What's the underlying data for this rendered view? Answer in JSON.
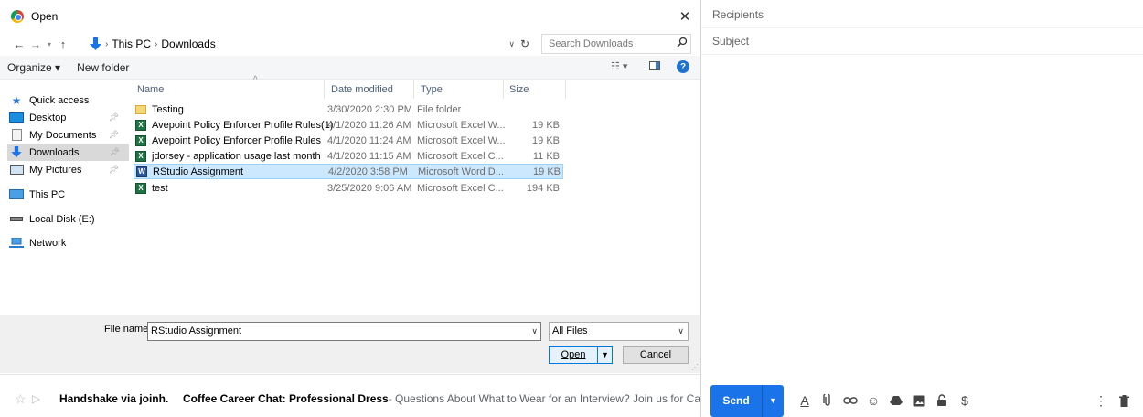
{
  "dialog": {
    "title": "Open",
    "address": {
      "crumbs": [
        "This PC",
        "Downloads"
      ]
    },
    "search_placeholder": "Search Downloads",
    "toolbar": {
      "organize": "Organize ▾",
      "new_folder": "New folder"
    },
    "sidebar": [
      {
        "label": "Quick access",
        "icon": "star-icon"
      },
      {
        "label": "Desktop",
        "icon": "desktop-icon",
        "pinned": true
      },
      {
        "label": "My Documents",
        "icon": "document-icon",
        "pinned": true
      },
      {
        "label": "Downloads",
        "icon": "download-arrow-icon",
        "pinned": true,
        "selected": true
      },
      {
        "label": "My Pictures",
        "icon": "pictures-icon",
        "pinned": true
      },
      {
        "label": "This PC",
        "icon": "computer-icon"
      },
      {
        "label": "Local Disk (E:)",
        "icon": "disk-icon"
      },
      {
        "label": "Network",
        "icon": "network-icon"
      }
    ],
    "columns": {
      "name": "Name",
      "date": "Date modified",
      "type": "Type",
      "size": "Size"
    },
    "files": [
      {
        "name": "Testing",
        "date": "3/30/2020 2:30 PM",
        "type": "File folder",
        "size": "",
        "icon": "folder-icon"
      },
      {
        "name": "Avepoint Policy Enforcer Profile Rules(1)",
        "date": "4/1/2020 11:26 AM",
        "type": "Microsoft Excel W...",
        "size": "19 KB",
        "icon": "excel-file-icon"
      },
      {
        "name": "Avepoint Policy Enforcer Profile Rules",
        "date": "4/1/2020 11:24 AM",
        "type": "Microsoft Excel W...",
        "size": "19 KB",
        "icon": "excel-file-icon"
      },
      {
        "name": "jdorsey - application usage last month",
        "date": "4/1/2020 11:15 AM",
        "type": "Microsoft Excel C...",
        "size": "11 KB",
        "icon": "excel-file-icon"
      },
      {
        "name": "RStudio Assignment",
        "date": "4/2/2020 3:58 PM",
        "type": "Microsoft Word D...",
        "size": "19 KB",
        "icon": "word-file-icon",
        "selected": true
      },
      {
        "name": "test",
        "date": "3/25/2020 9:06 AM",
        "type": "Microsoft Excel C...",
        "size": "194 KB",
        "icon": "excel-file-icon"
      }
    ],
    "file_name_label": "File name:",
    "file_name_value": "RStudio Assignment",
    "filter_value": "All Files",
    "open_label": "Open",
    "cancel_label": "Cancel"
  },
  "compose": {
    "recipients_placeholder": "Recipients",
    "subject_placeholder": "Subject",
    "send_label": "Send",
    "accent_color": "#1a73e8"
  },
  "inbox_row": {
    "sender": "Handshake via joinh.",
    "subject": "Coffee Career Chat: Professional Dress",
    "snippet": " - Questions About What to Wear for an Interview? Join us for Ca"
  }
}
